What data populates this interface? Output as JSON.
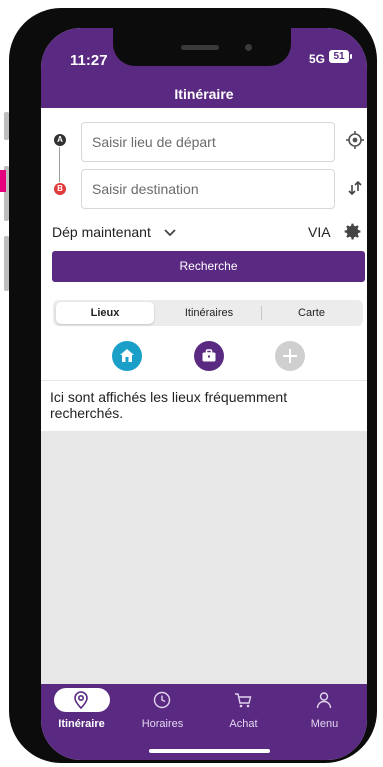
{
  "status": {
    "time": "11:27",
    "network": "5G",
    "battery": "51"
  },
  "header": {
    "title": "Itinéraire"
  },
  "route": {
    "from_marker": "A",
    "to_marker": "B",
    "from_placeholder": "Saisir lieu de départ",
    "to_placeholder": "Saisir destination"
  },
  "options": {
    "departure": "Dép maintenant",
    "via": "VIA"
  },
  "search_button": "Recherche",
  "tabs": [
    "Lieux",
    "Itinéraires",
    "Carte"
  ],
  "quick_places": [
    "home-icon",
    "briefcase-icon",
    "plus-icon"
  ],
  "info_text": "Ici sont affichés les lieux fréquemment recherchés.",
  "bottom_nav": [
    {
      "label": "Itinéraire",
      "icon": "location-pin-icon",
      "active": true
    },
    {
      "label": "Horaires",
      "icon": "clock-icon",
      "active": false
    },
    {
      "label": "Achat",
      "icon": "cart-icon",
      "active": false
    },
    {
      "label": "Menu",
      "icon": "person-icon",
      "active": false
    }
  ],
  "colors": {
    "brand": "#5a2a82",
    "home": "#1aa0c8",
    "work": "#5a2a82",
    "add": "#cfcfcf",
    "marker_b": "#e03a3a"
  }
}
